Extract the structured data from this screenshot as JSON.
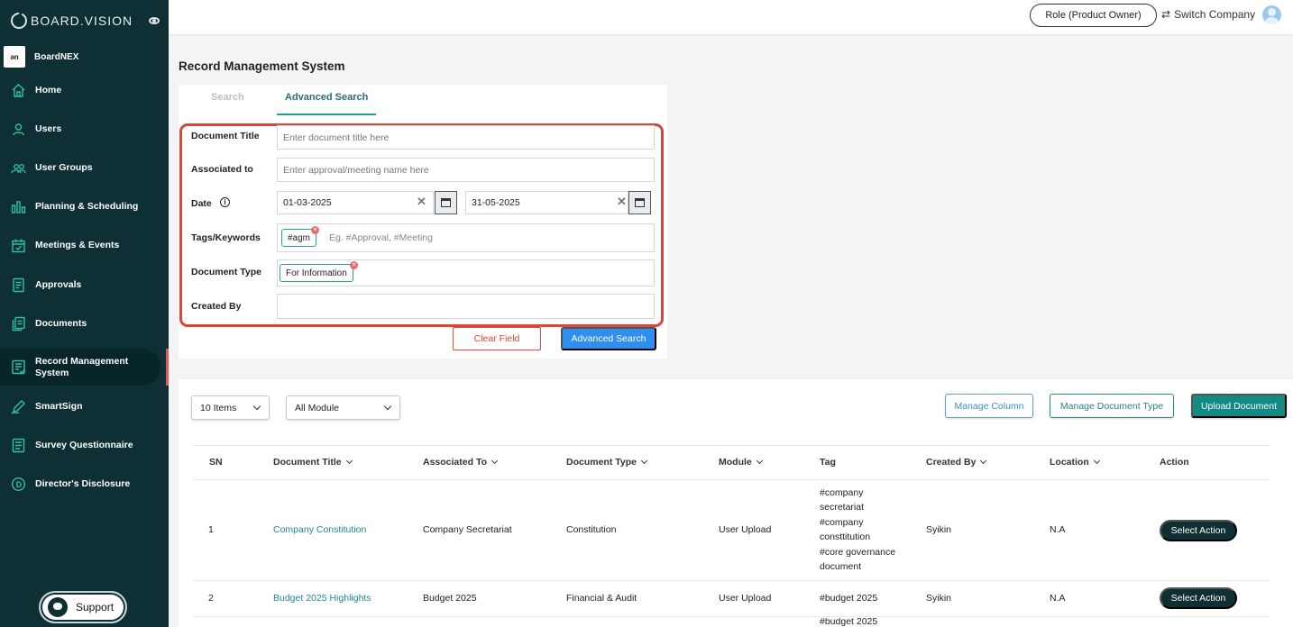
{
  "brand": {
    "name": "BOARD.VISION"
  },
  "org": {
    "logo_text": "ən",
    "name": "BoardNEX"
  },
  "nav": [
    {
      "label": "Home",
      "icon": "home-icon"
    },
    {
      "label": "Users",
      "icon": "user-icon"
    },
    {
      "label": "User Groups",
      "icon": "user-group-icon"
    },
    {
      "label": "Planning & Scheduling",
      "icon": "chart-icon"
    },
    {
      "label": "Meetings & Events",
      "icon": "calendar-icon"
    },
    {
      "label": "Approvals",
      "icon": "approval-icon"
    },
    {
      "label": "Documents",
      "icon": "documents-icon"
    },
    {
      "label": "Record Management System",
      "icon": "records-icon",
      "active": true
    },
    {
      "label": "SmartSign",
      "icon": "pen-icon"
    },
    {
      "label": "Survey Questionnaire",
      "icon": "survey-icon"
    },
    {
      "label": "Director's Disclosure",
      "icon": "disclosure-icon"
    }
  ],
  "support": {
    "label": "Support"
  },
  "topbar": {
    "role": "Role (Product Owner)",
    "switch_company": "Switch Company"
  },
  "page": {
    "title": "Record Management System"
  },
  "tabs": {
    "search": "Search",
    "advanced": "Advanced Search"
  },
  "form": {
    "doc_title_label": "Document Title",
    "doc_title_placeholder": "Enter document title here",
    "associated_label": "Associated to",
    "associated_placeholder": "Enter approval/meeting name here",
    "date_label": "Date",
    "date_from": "01-03-2025",
    "date_to": "31-05-2025",
    "tags_label": "Tags/Keywords",
    "tag_chip": "#agm",
    "tags_placeholder": "Eg. #Approval, #Meeting",
    "doctype_label": "Document Type",
    "doctype_chip": "For Information",
    "created_by_label": "Created By",
    "created_by_value": "",
    "clear_label": "Clear Field",
    "search_label": "Advanced Search"
  },
  "toolbar": {
    "items_select": "10 Items",
    "module_select": "All Module",
    "manage_column": "Manage Column",
    "manage_doc_type": "Manage Document Type",
    "upload": "Upload Document"
  },
  "table": {
    "headers": [
      "SN",
      "Document Title",
      "Associated To",
      "Document Type",
      "Module",
      "Tag",
      "Created By",
      "Location",
      "Action"
    ],
    "rows": [
      {
        "sn": "1",
        "title": "Company Constitution",
        "associated": "Company Secretariat",
        "type": "Constitution",
        "module": "User Upload",
        "tag_lines": [
          "#company",
          "secretariat",
          "#company",
          "consttitution",
          "#core governance",
          "document"
        ],
        "created_by": "Syikin",
        "location": "N.A",
        "action": "Select Action"
      },
      {
        "sn": "2",
        "title": "Budget 2025 Highlights",
        "associated": "Budget 2025",
        "type": "Financial & Audit",
        "module": "User Upload",
        "tag_lines": [
          "#budget 2025"
        ],
        "created_by": "Syikin",
        "location": "N.A",
        "action": "Select Action"
      }
    ],
    "partial_row_tag": "#budget 2025"
  }
}
